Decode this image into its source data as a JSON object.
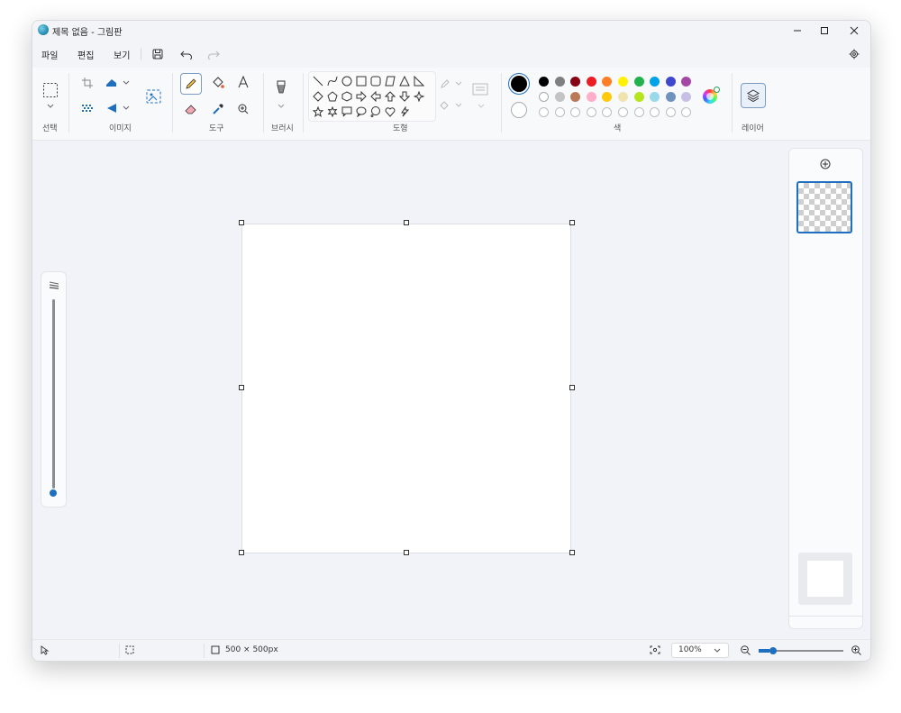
{
  "window": {
    "title": "제목 없음 - 그림판",
    "minimize_icon": "minimize-icon",
    "maximize_icon": "maximize-icon",
    "close_icon": "close-icon"
  },
  "menu": {
    "items": [
      "파일",
      "편집",
      "보기"
    ],
    "save_icon": "save-icon",
    "undo_icon": "undo-icon",
    "redo_icon": "redo-icon",
    "settings_icon": "gear-icon"
  },
  "ribbon": {
    "groups": {
      "selection": "선택",
      "image": "이미지",
      "tools": "도구",
      "brushes": "브러시",
      "shapes": "도형",
      "colors": "색",
      "layers": "레이어"
    },
    "colors": {
      "primary": "#000000",
      "secondary": "#ffffff",
      "row1": [
        "#000000",
        "#7f7f7f",
        "#880015",
        "#ed1c24",
        "#ff7f27",
        "#fff200",
        "#22b14c",
        "#00a2e8",
        "#3f48cc",
        "#a349a4"
      ],
      "row2": [
        "#ffffff",
        "#c3c3c3",
        "#b97a57",
        "#ffaec9",
        "#ffc90e",
        "#efe4b0",
        "#b5e61d",
        "#99d9ea",
        "#7092be",
        "#c8bfe7"
      ],
      "row3_empty_count": "10"
    }
  },
  "statusbar": {
    "canvas_size": "500 × 500px",
    "zoom": "100%"
  }
}
